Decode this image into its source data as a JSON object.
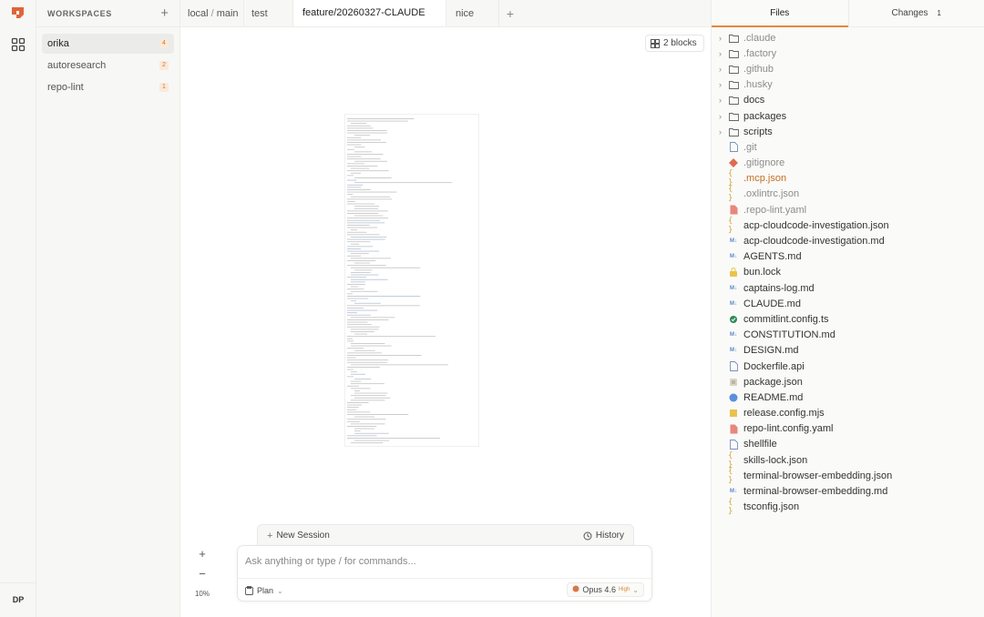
{
  "workspaces": {
    "title": "WORKSPACES",
    "add_label": "+",
    "items": [
      {
        "name": "orika",
        "badge": "4"
      },
      {
        "name": "autoresearch",
        "badge": "2"
      },
      {
        "name": "repo-lint",
        "badge": "1"
      }
    ]
  },
  "rail": {
    "avatar": "DP"
  },
  "tabs": {
    "local": {
      "prefix": "local",
      "separator": "/",
      "branch": "main"
    },
    "test": "test",
    "feature": "feature/20260327-CLAUDE",
    "nice": "nice",
    "add_label": "+"
  },
  "canvas": {
    "blocks_label": "2 blocks",
    "zoom_in": "+",
    "zoom_out": "−",
    "zoom_level": "10%"
  },
  "session": {
    "new_label": "New Session",
    "history_label": "History"
  },
  "composer": {
    "placeholder": "Ask anything or type / for commands...",
    "mode": "Plan",
    "model": "Opus 4.6",
    "effort": "High"
  },
  "files_panel": {
    "tab_files": "Files",
    "tab_changes": "Changes",
    "changes_count": "1",
    "folders": [
      ".claude",
      ".factory",
      ".github",
      ".husky",
      "docs",
      "packages",
      "scripts"
    ],
    "files": [
      {
        "name": ".git",
        "icon": "file-icon",
        "style": "dim"
      },
      {
        "name": ".gitignore",
        "icon": "git-icon",
        "style": "dim"
      },
      {
        "name": ".mcp.json",
        "icon": "json-icon",
        "style": "orange"
      },
      {
        "name": ".oxlintrc.json",
        "icon": "json-icon",
        "style": "dim"
      },
      {
        "name": ".repo-lint.yaml",
        "icon": "yaml-icon",
        "style": "dim"
      },
      {
        "name": "acp-cloudcode-investigation.json",
        "icon": "json-icon",
        "style": ""
      },
      {
        "name": "acp-cloudcode-investigation.md",
        "icon": "markdown-icon",
        "style": ""
      },
      {
        "name": "AGENTS.md",
        "icon": "markdown-icon",
        "style": ""
      },
      {
        "name": "bun.lock",
        "icon": "lock-icon",
        "style": ""
      },
      {
        "name": "captains-log.md",
        "icon": "markdown-icon",
        "style": ""
      },
      {
        "name": "CLAUDE.md",
        "icon": "markdown-icon",
        "style": ""
      },
      {
        "name": "commitlint.config.ts",
        "icon": "commitlint-icon",
        "style": ""
      },
      {
        "name": "CONSTITUTION.md",
        "icon": "markdown-icon",
        "style": ""
      },
      {
        "name": "DESIGN.md",
        "icon": "markdown-icon",
        "style": ""
      },
      {
        "name": "Dockerfile.api",
        "icon": "file-icon",
        "style": ""
      },
      {
        "name": "package.json",
        "icon": "package-icon",
        "style": ""
      },
      {
        "name": "README.md",
        "icon": "info-icon",
        "style": ""
      },
      {
        "name": "release.config.mjs",
        "icon": "js-icon",
        "style": ""
      },
      {
        "name": "repo-lint.config.yaml",
        "icon": "yaml-icon",
        "style": ""
      },
      {
        "name": "shellfile",
        "icon": "file-icon",
        "style": ""
      },
      {
        "name": "skills-lock.json",
        "icon": "json-icon",
        "style": ""
      },
      {
        "name": "terminal-browser-embedding.json",
        "icon": "json-icon",
        "style": ""
      },
      {
        "name": "terminal-browser-embedding.md",
        "icon": "markdown-icon",
        "style": ""
      },
      {
        "name": "tsconfig.json",
        "icon": "json-icon",
        "style": ""
      }
    ]
  },
  "colors": {
    "accent": "#e6873a",
    "brand": "#e0643a",
    "badge_text": "#c97a3a",
    "badge_bg": "#fbe9d9"
  }
}
